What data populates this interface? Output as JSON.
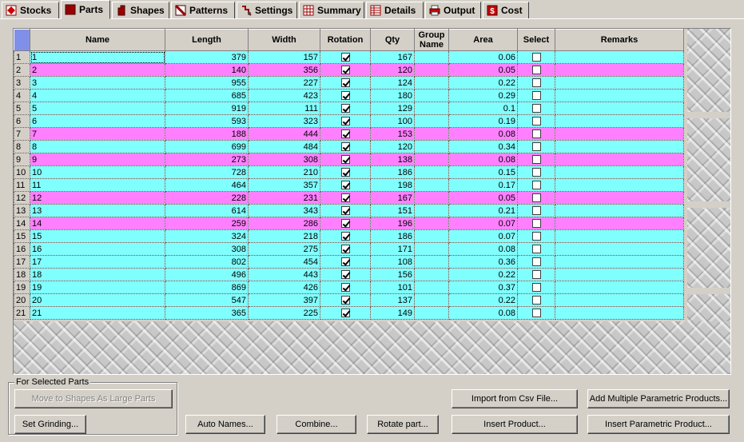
{
  "tabs": [
    {
      "label": "Stocks",
      "icon": "stocks-icon",
      "active": false
    },
    {
      "label": "Parts",
      "icon": "parts-icon",
      "active": true
    },
    {
      "label": "Shapes",
      "icon": "shapes-icon",
      "active": false
    },
    {
      "label": "Patterns",
      "icon": "patterns-icon",
      "active": false
    },
    {
      "label": "Settings",
      "icon": "settings-icon",
      "active": false
    },
    {
      "label": "Summary",
      "icon": "summary-icon",
      "active": false
    },
    {
      "label": "Details",
      "icon": "details-icon",
      "active": false
    },
    {
      "label": "Output",
      "icon": "printer-icon",
      "active": false
    },
    {
      "label": "Cost",
      "icon": "dollar-icon",
      "active": false
    }
  ],
  "grid": {
    "columns": [
      "Name",
      "Length",
      "Width",
      "Rotation",
      "Qty",
      "Group Name",
      "Area",
      "Select",
      "Remarks"
    ],
    "colors": {
      "normal": "#80ffff",
      "highlight": "#ff80ff",
      "corner": "#8090e8"
    },
    "rows": [
      {
        "n": "1",
        "name": "1",
        "length": "379",
        "width": "157",
        "rotation": true,
        "qty": "167",
        "group": "",
        "area": "0.06",
        "select": false,
        "remarks": "",
        "highlight": false
      },
      {
        "n": "2",
        "name": "2",
        "length": "140",
        "width": "356",
        "rotation": true,
        "qty": "120",
        "group": "",
        "area": "0.05",
        "select": false,
        "remarks": "",
        "highlight": true
      },
      {
        "n": "3",
        "name": "3",
        "length": "955",
        "width": "227",
        "rotation": true,
        "qty": "124",
        "group": "",
        "area": "0.22",
        "select": false,
        "remarks": "",
        "highlight": false
      },
      {
        "n": "4",
        "name": "4",
        "length": "685",
        "width": "423",
        "rotation": true,
        "qty": "180",
        "group": "",
        "area": "0.29",
        "select": false,
        "remarks": "",
        "highlight": false
      },
      {
        "n": "5",
        "name": "5",
        "length": "919",
        "width": "111",
        "rotation": true,
        "qty": "129",
        "group": "",
        "area": "0.1",
        "select": false,
        "remarks": "",
        "highlight": false
      },
      {
        "n": "6",
        "name": "6",
        "length": "593",
        "width": "323",
        "rotation": true,
        "qty": "100",
        "group": "",
        "area": "0.19",
        "select": false,
        "remarks": "",
        "highlight": false
      },
      {
        "n": "7",
        "name": "7",
        "length": "188",
        "width": "444",
        "rotation": true,
        "qty": "153",
        "group": "",
        "area": "0.08",
        "select": false,
        "remarks": "",
        "highlight": true
      },
      {
        "n": "8",
        "name": "8",
        "length": "699",
        "width": "484",
        "rotation": true,
        "qty": "120",
        "group": "",
        "area": "0.34",
        "select": false,
        "remarks": "",
        "highlight": false
      },
      {
        "n": "9",
        "name": "9",
        "length": "273",
        "width": "308",
        "rotation": true,
        "qty": "138",
        "group": "",
        "area": "0.08",
        "select": false,
        "remarks": "",
        "highlight": true
      },
      {
        "n": "10",
        "name": "10",
        "length": "728",
        "width": "210",
        "rotation": true,
        "qty": "186",
        "group": "",
        "area": "0.15",
        "select": false,
        "remarks": "",
        "highlight": false
      },
      {
        "n": "11",
        "name": "11",
        "length": "464",
        "width": "357",
        "rotation": true,
        "qty": "198",
        "group": "",
        "area": "0.17",
        "select": false,
        "remarks": "",
        "highlight": false
      },
      {
        "n": "12",
        "name": "12",
        "length": "228",
        "width": "231",
        "rotation": true,
        "qty": "167",
        "group": "",
        "area": "0.05",
        "select": false,
        "remarks": "",
        "highlight": true
      },
      {
        "n": "13",
        "name": "13",
        "length": "614",
        "width": "343",
        "rotation": true,
        "qty": "151",
        "group": "",
        "area": "0.21",
        "select": false,
        "remarks": "",
        "highlight": false
      },
      {
        "n": "14",
        "name": "14",
        "length": "259",
        "width": "286",
        "rotation": true,
        "qty": "196",
        "group": "",
        "area": "0.07",
        "select": false,
        "remarks": "",
        "highlight": true
      },
      {
        "n": "15",
        "name": "15",
        "length": "324",
        "width": "218",
        "rotation": true,
        "qty": "186",
        "group": "",
        "area": "0.07",
        "select": false,
        "remarks": "",
        "highlight": false
      },
      {
        "n": "16",
        "name": "16",
        "length": "308",
        "width": "275",
        "rotation": true,
        "qty": "171",
        "group": "",
        "area": "0.08",
        "select": false,
        "remarks": "",
        "highlight": false
      },
      {
        "n": "17",
        "name": "17",
        "length": "802",
        "width": "454",
        "rotation": true,
        "qty": "108",
        "group": "",
        "area": "0.36",
        "select": false,
        "remarks": "",
        "highlight": false
      },
      {
        "n": "18",
        "name": "18",
        "length": "496",
        "width": "443",
        "rotation": true,
        "qty": "156",
        "group": "",
        "area": "0.22",
        "select": false,
        "remarks": "",
        "highlight": false
      },
      {
        "n": "19",
        "name": "19",
        "length": "869",
        "width": "426",
        "rotation": true,
        "qty": "101",
        "group": "",
        "area": "0.37",
        "select": false,
        "remarks": "",
        "highlight": false
      },
      {
        "n": "20",
        "name": "20",
        "length": "547",
        "width": "397",
        "rotation": true,
        "qty": "137",
        "group": "",
        "area": "0.22",
        "select": false,
        "remarks": "",
        "highlight": false
      },
      {
        "n": "21",
        "name": "21",
        "length": "365",
        "width": "225",
        "rotation": true,
        "qty": "149",
        "group": "",
        "area": "0.08",
        "select": false,
        "remarks": "",
        "highlight": false
      }
    ]
  },
  "selected_parts": {
    "label": "For Selected Parts",
    "move_label": "Move to Shapes As Large Parts",
    "grinding_label": "Set Grinding..."
  },
  "buttons": {
    "auto_names": "Auto Names...",
    "combine": "Combine...",
    "rotate": "Rotate part...",
    "import_csv": "Import from Csv File...",
    "insert_product": "Insert Product...",
    "add_multiple": "Add Multiple Parametric Products...",
    "insert_parametric": "Insert Parametric Product..."
  }
}
